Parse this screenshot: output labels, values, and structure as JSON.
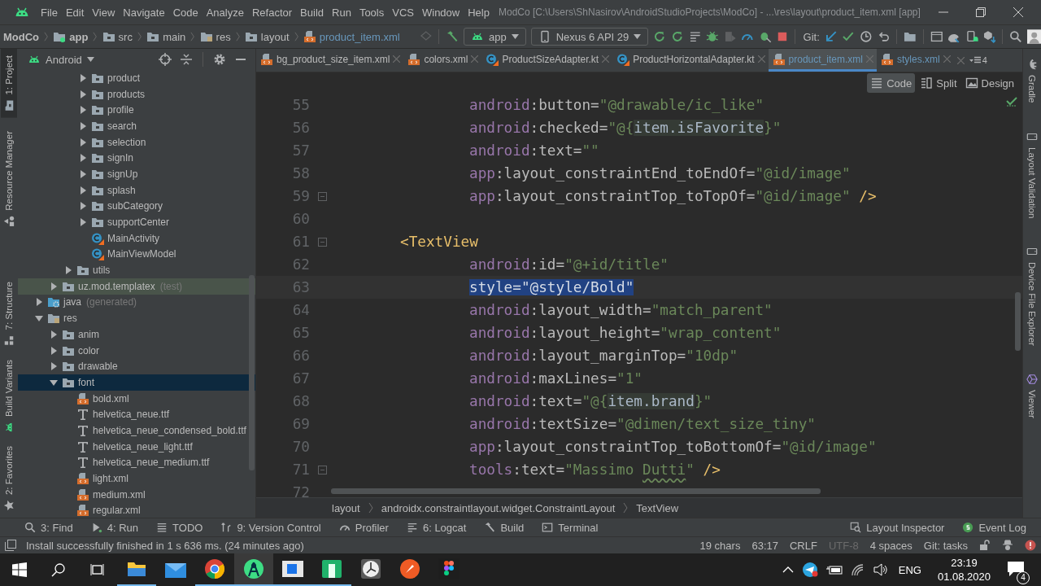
{
  "menu_bar": {
    "items": [
      "File",
      "Edit",
      "View",
      "Navigate",
      "Code",
      "Analyze",
      "Refactor",
      "Build",
      "Run",
      "Tools",
      "VCS",
      "Window",
      "Help"
    ],
    "title": "ModCo [C:\\Users\\ShNasirov\\AndroidStudioProjects\\ModCo] - ...\\res\\layout\\product_item.xml [app]"
  },
  "nav_bar": {
    "breadcrumbs": [
      {
        "label": "ModCo",
        "kind": "project"
      },
      {
        "label": "app",
        "kind": "module"
      },
      {
        "label": "src",
        "kind": "folder"
      },
      {
        "label": "main",
        "kind": "folder"
      },
      {
        "label": "res",
        "kind": "res"
      },
      {
        "label": "layout",
        "kind": "folder"
      },
      {
        "label": "product_item.xml",
        "kind": "xml",
        "modified": true
      }
    ],
    "run_config": "app",
    "device": "Nexus 6 API 29",
    "git_label": "Git:"
  },
  "left_stripe": {
    "top": [
      {
        "label": "1: Project",
        "kind": "project",
        "selected": true
      },
      {
        "label": "Resource Manager",
        "kind": "resources",
        "selected": false
      }
    ],
    "bottom": [
      {
        "label": "7: Structure",
        "kind": "structure",
        "selected": false
      },
      {
        "label": "Build Variants",
        "kind": "variants",
        "selected": false
      },
      {
        "label": "2: Favorites",
        "kind": "favorites",
        "selected": false
      }
    ]
  },
  "project_panel": {
    "view": "Android",
    "tree": [
      {
        "children": [
          {
            "children": [
              {
                "children": [
                  {
                    "label": "product",
                    "kind": "folder",
                    "expanded": false,
                    "selected": false
                  },
                  {
                    "label": "products",
                    "kind": "folder",
                    "expanded": false,
                    "selected": false
                  },
                  {
                    "label": "profile",
                    "kind": "folder",
                    "expanded": false,
                    "selected": false
                  },
                  {
                    "label": "search",
                    "kind": "folder",
                    "expanded": false,
                    "selected": false
                  },
                  {
                    "label": "selection",
                    "kind": "folder",
                    "expanded": false,
                    "selected": false
                  },
                  {
                    "label": "signIn",
                    "kind": "folder",
                    "expanded": false,
                    "selected": false
                  },
                  {
                    "label": "signUp",
                    "kind": "folder",
                    "expanded": false,
                    "selected": false
                  },
                  {
                    "label": "splash",
                    "kind": "folder",
                    "expanded": false,
                    "selected": false
                  },
                  {
                    "label": "subCategory",
                    "kind": "folder",
                    "expanded": false,
                    "selected": false
                  },
                  {
                    "label": "supportCenter",
                    "kind": "folder",
                    "expanded": false,
                    "selected": false
                  },
                  {
                    "label": "MainActivity",
                    "kind": "kotlin",
                    "selected": false
                  },
                  {
                    "label": "MainViewModel",
                    "kind": "kotlin",
                    "selected": false
                  }
                ]
              },
              {
                "label": "utils",
                "kind": "folder",
                "expanded": false,
                "selected": false
              }
            ]
          },
          {
            "label": "uz.mod.templatex",
            "note": "(test)",
            "kind": "test",
            "expanded": false,
            "selected": false
          }
        ]
      },
      {
        "label": "java",
        "note": "(generated)",
        "kind": "java",
        "expanded": false,
        "selected": false
      },
      {
        "label": "res",
        "kind": "res",
        "expanded": true,
        "selected": false,
        "children": [
          {
            "label": "anim",
            "kind": "folder",
            "expanded": false,
            "selected": false
          },
          {
            "label": "color",
            "kind": "folder",
            "expanded": false,
            "selected": false
          },
          {
            "label": "drawable",
            "kind": "folder",
            "expanded": false,
            "selected": false
          },
          {
            "label": "font",
            "kind": "folder",
            "expanded": true,
            "selected": true,
            "children": [
              {
                "label": "bold.xml",
                "kind": "xml",
                "selected": false
              },
              {
                "label": "helvetica_neue.ttf",
                "kind": "font",
                "selected": false
              },
              {
                "label": "helvetica_neue_condensed_bold.ttf",
                "kind": "font",
                "selected": false
              },
              {
                "label": "helvetica_neue_light.ttf",
                "kind": "font",
                "selected": false
              },
              {
                "label": "helvetica_neue_medium.ttf",
                "kind": "font",
                "selected": false
              },
              {
                "label": "light.xml",
                "kind": "xml",
                "selected": false
              },
              {
                "label": "medium.xml",
                "kind": "xml",
                "selected": false
              },
              {
                "label": "regular.xml",
                "kind": "xml",
                "selected": false
              }
            ]
          }
        ]
      }
    ]
  },
  "editor": {
    "tabs": [
      {
        "label": "bg_product_size_item.xml",
        "kind": "xml",
        "modified": false,
        "selected": false
      },
      {
        "label": "colors.xml",
        "kind": "xml",
        "modified": false,
        "selected": false
      },
      {
        "label": "ProductSizeAdapter.kt",
        "kind": "kotlin",
        "modified": false,
        "selected": false
      },
      {
        "label": "ProductHorizontalAdapter.kt",
        "kind": "kotlin",
        "modified": false,
        "selected": false
      },
      {
        "label": "product_item.xml",
        "kind": "xml",
        "modified": true,
        "selected": true
      },
      {
        "label": "styles.xml",
        "kind": "xml",
        "modified": true,
        "selected": false
      }
    ],
    "hidden_tabs": "4",
    "modes": [
      {
        "label": "Code",
        "kind": "code",
        "selected": true
      },
      {
        "label": "Split",
        "kind": "split",
        "selected": false
      },
      {
        "label": "Design",
        "kind": "design",
        "selected": false
      }
    ],
    "lines": [
      {
        "number": "55",
        "kind": "attribute",
        "fold": false,
        "current": false,
        "parts": [
          {
            "text": "android",
            "kind": "ns"
          },
          {
            "text": ":",
            "kind": "punct"
          },
          {
            "text": "button",
            "kind": "attr"
          },
          {
            "text": "=",
            "kind": "punct"
          },
          {
            "text": "\"@drawable/ic_like\"",
            "kind": "value"
          }
        ]
      },
      {
        "number": "56",
        "kind": "attribute",
        "fold": false,
        "current": false,
        "parts": [
          {
            "text": "android",
            "kind": "ns"
          },
          {
            "text": ":",
            "kind": "punct"
          },
          {
            "text": "checked",
            "kind": "attr"
          },
          {
            "text": "=",
            "kind": "punct"
          },
          {
            "text": "\"@{",
            "kind": "value"
          },
          {
            "text": "item.isFavorite",
            "kind": "inject"
          },
          {
            "text": "}\"",
            "kind": "value"
          }
        ]
      },
      {
        "number": "57",
        "kind": "attribute",
        "fold": false,
        "current": false,
        "parts": [
          {
            "text": "android",
            "kind": "ns"
          },
          {
            "text": ":",
            "kind": "punct"
          },
          {
            "text": "text",
            "kind": "attr"
          },
          {
            "text": "=",
            "kind": "punct"
          },
          {
            "text": "\"\"",
            "kind": "value"
          }
        ]
      },
      {
        "number": "58",
        "kind": "attribute",
        "fold": false,
        "current": false,
        "parts": [
          {
            "text": "app",
            "kind": "ns"
          },
          {
            "text": ":",
            "kind": "punct"
          },
          {
            "text": "layout_constraintEnd_toEndOf",
            "kind": "attr"
          },
          {
            "text": "=",
            "kind": "punct"
          },
          {
            "text": "\"@id/image\"",
            "kind": "value"
          }
        ]
      },
      {
        "number": "59",
        "kind": "attribute",
        "fold": true,
        "current": false,
        "parts": [
          {
            "text": "app",
            "kind": "ns"
          },
          {
            "text": ":",
            "kind": "punct"
          },
          {
            "text": "layout_constraintTop_toTopOf",
            "kind": "attr"
          },
          {
            "text": "=",
            "kind": "punct"
          },
          {
            "text": "\"@id/image\"",
            "kind": "value"
          },
          {
            "text": " />",
            "kind": "tag"
          }
        ]
      },
      {
        "number": "60",
        "kind": "blank",
        "fold": false,
        "current": false
      },
      {
        "number": "61",
        "kind": "tag",
        "fold": true,
        "current": false,
        "parts": [
          {
            "text": "<TextView",
            "kind": "tag"
          }
        ]
      },
      {
        "number": "62",
        "kind": "attribute",
        "fold": false,
        "current": false,
        "parts": [
          {
            "text": "android",
            "kind": "ns"
          },
          {
            "text": ":",
            "kind": "punct"
          },
          {
            "text": "id",
            "kind": "attr"
          },
          {
            "text": "=",
            "kind": "punct"
          },
          {
            "text": "\"@+id/title\"",
            "kind": "value"
          }
        ]
      },
      {
        "number": "63",
        "kind": "attribute",
        "fold": false,
        "current": true,
        "parts": [
          {
            "text": "style=\"@style/Bold\"",
            "kind": "selected"
          }
        ]
      },
      {
        "number": "64",
        "kind": "attribute",
        "fold": false,
        "current": false,
        "parts": [
          {
            "text": "android",
            "kind": "ns"
          },
          {
            "text": ":",
            "kind": "punct"
          },
          {
            "text": "layout_width",
            "kind": "attr"
          },
          {
            "text": "=",
            "kind": "punct"
          },
          {
            "text": "\"match_parent\"",
            "kind": "value"
          }
        ]
      },
      {
        "number": "65",
        "kind": "attribute",
        "fold": false,
        "current": false,
        "parts": [
          {
            "text": "android",
            "kind": "ns"
          },
          {
            "text": ":",
            "kind": "punct"
          },
          {
            "text": "layout_height",
            "kind": "attr"
          },
          {
            "text": "=",
            "kind": "punct"
          },
          {
            "text": "\"wrap_content\"",
            "kind": "value"
          }
        ]
      },
      {
        "number": "66",
        "kind": "attribute",
        "fold": false,
        "current": false,
        "parts": [
          {
            "text": "android",
            "kind": "ns"
          },
          {
            "text": ":",
            "kind": "punct"
          },
          {
            "text": "layout_marginTop",
            "kind": "attr"
          },
          {
            "text": "=",
            "kind": "punct"
          },
          {
            "text": "\"10dp\"",
            "kind": "value"
          }
        ]
      },
      {
        "number": "67",
        "kind": "attribute",
        "fold": false,
        "current": false,
        "parts": [
          {
            "text": "android",
            "kind": "ns"
          },
          {
            "text": ":",
            "kind": "punct"
          },
          {
            "text": "maxLines",
            "kind": "attr"
          },
          {
            "text": "=",
            "kind": "punct"
          },
          {
            "text": "\"1\"",
            "kind": "value"
          }
        ]
      },
      {
        "number": "68",
        "kind": "attribute",
        "fold": false,
        "current": false,
        "parts": [
          {
            "text": "android",
            "kind": "ns"
          },
          {
            "text": ":",
            "kind": "punct"
          },
          {
            "text": "text",
            "kind": "attr"
          },
          {
            "text": "=",
            "kind": "punct"
          },
          {
            "text": "\"@{",
            "kind": "value"
          },
          {
            "text": "item.brand",
            "kind": "inject"
          },
          {
            "text": "}\"",
            "kind": "value"
          }
        ]
      },
      {
        "number": "69",
        "kind": "attribute",
        "fold": false,
        "current": false,
        "parts": [
          {
            "text": "android",
            "kind": "ns"
          },
          {
            "text": ":",
            "kind": "punct"
          },
          {
            "text": "textSize",
            "kind": "attr"
          },
          {
            "text": "=",
            "kind": "punct"
          },
          {
            "text": "\"@dimen/text_size_tiny\"",
            "kind": "value"
          }
        ]
      },
      {
        "number": "70",
        "kind": "attribute",
        "fold": false,
        "current": false,
        "parts": [
          {
            "text": "app",
            "kind": "ns"
          },
          {
            "text": ":",
            "kind": "punct"
          },
          {
            "text": "layout_constraintTop_toBottomOf",
            "kind": "attr"
          },
          {
            "text": "=",
            "kind": "punct"
          },
          {
            "text": "\"@id/image\"",
            "kind": "value"
          }
        ]
      },
      {
        "number": "71",
        "kind": "attribute",
        "fold": true,
        "current": false,
        "parts": [
          {
            "text": "tools",
            "kind": "ns"
          },
          {
            "text": ":",
            "kind": "punct"
          },
          {
            "text": "text",
            "kind": "attr"
          },
          {
            "text": "=",
            "kind": "punct"
          },
          {
            "text": "\"Massimo ",
            "kind": "value"
          },
          {
            "text": "Dutti",
            "kind": "typo"
          },
          {
            "text": "\"",
            "kind": "value"
          },
          {
            "text": " />",
            "kind": "tag"
          }
        ]
      },
      {
        "number": "72",
        "kind": "blank",
        "fold": false,
        "current": false
      }
    ],
    "breadcrumbs": [
      "layout",
      "androidx.constraintlayout.widget.ConstraintLayout",
      "TextView"
    ]
  },
  "right_stripe": [
    {
      "label": "Gradle",
      "kind": "gradle"
    },
    {
      "label": "Layout Validation",
      "kind": "validation"
    },
    {
      "label": "Device File Explorer",
      "kind": "device"
    },
    {
      "label": "Viewer",
      "kind": "viewer"
    }
  ],
  "tool_windows": {
    "left": [
      {
        "label": "3: Find",
        "kind": "find"
      },
      {
        "label": "4: Run",
        "kind": "run"
      },
      {
        "label": "TODO",
        "kind": "todo"
      },
      {
        "label": "9: Version Control",
        "kind": "vcs"
      },
      {
        "label": "Profiler",
        "kind": "profiler"
      },
      {
        "label": "6: Logcat",
        "kind": "logcat"
      },
      {
        "label": "Build",
        "kind": "build"
      },
      {
        "label": "Terminal",
        "kind": "terminal"
      }
    ],
    "right": [
      {
        "label": "Layout Inspector",
        "kind": "inspector"
      },
      {
        "label": "Event Log",
        "kind": "eventlog"
      }
    ]
  },
  "status_bar": {
    "message": "Install successfully finished in 1 s 636 ms. (24 minutes ago)",
    "items": [
      {
        "text": "19 chars",
        "disabled": false
      },
      {
        "text": "63:17",
        "disabled": false
      },
      {
        "text": "CRLF",
        "disabled": false
      },
      {
        "text": "UTF-8",
        "disabled": true
      },
      {
        "text": "4 spaces",
        "disabled": false
      },
      {
        "text": "Git: tasks",
        "disabled": false
      }
    ]
  },
  "taskbar": {
    "apps": [
      {
        "kind": "explorer",
        "open": true,
        "selected": false
      },
      {
        "kind": "mail",
        "open": false,
        "selected": false
      },
      {
        "kind": "chrome",
        "open": true,
        "selected": false
      },
      {
        "kind": "studio",
        "open": true,
        "selected": true
      },
      {
        "kind": "blue",
        "open": true,
        "selected": false
      },
      {
        "kind": "green",
        "open": true,
        "selected": false
      },
      {
        "kind": "clock",
        "open": false,
        "selected": false
      },
      {
        "kind": "postman",
        "open": false,
        "selected": false
      },
      {
        "kind": "figma",
        "open": false,
        "selected": false
      }
    ],
    "language": "ENG",
    "time": "23:19",
    "date": "01.08.2020",
    "notifications": "4"
  }
}
